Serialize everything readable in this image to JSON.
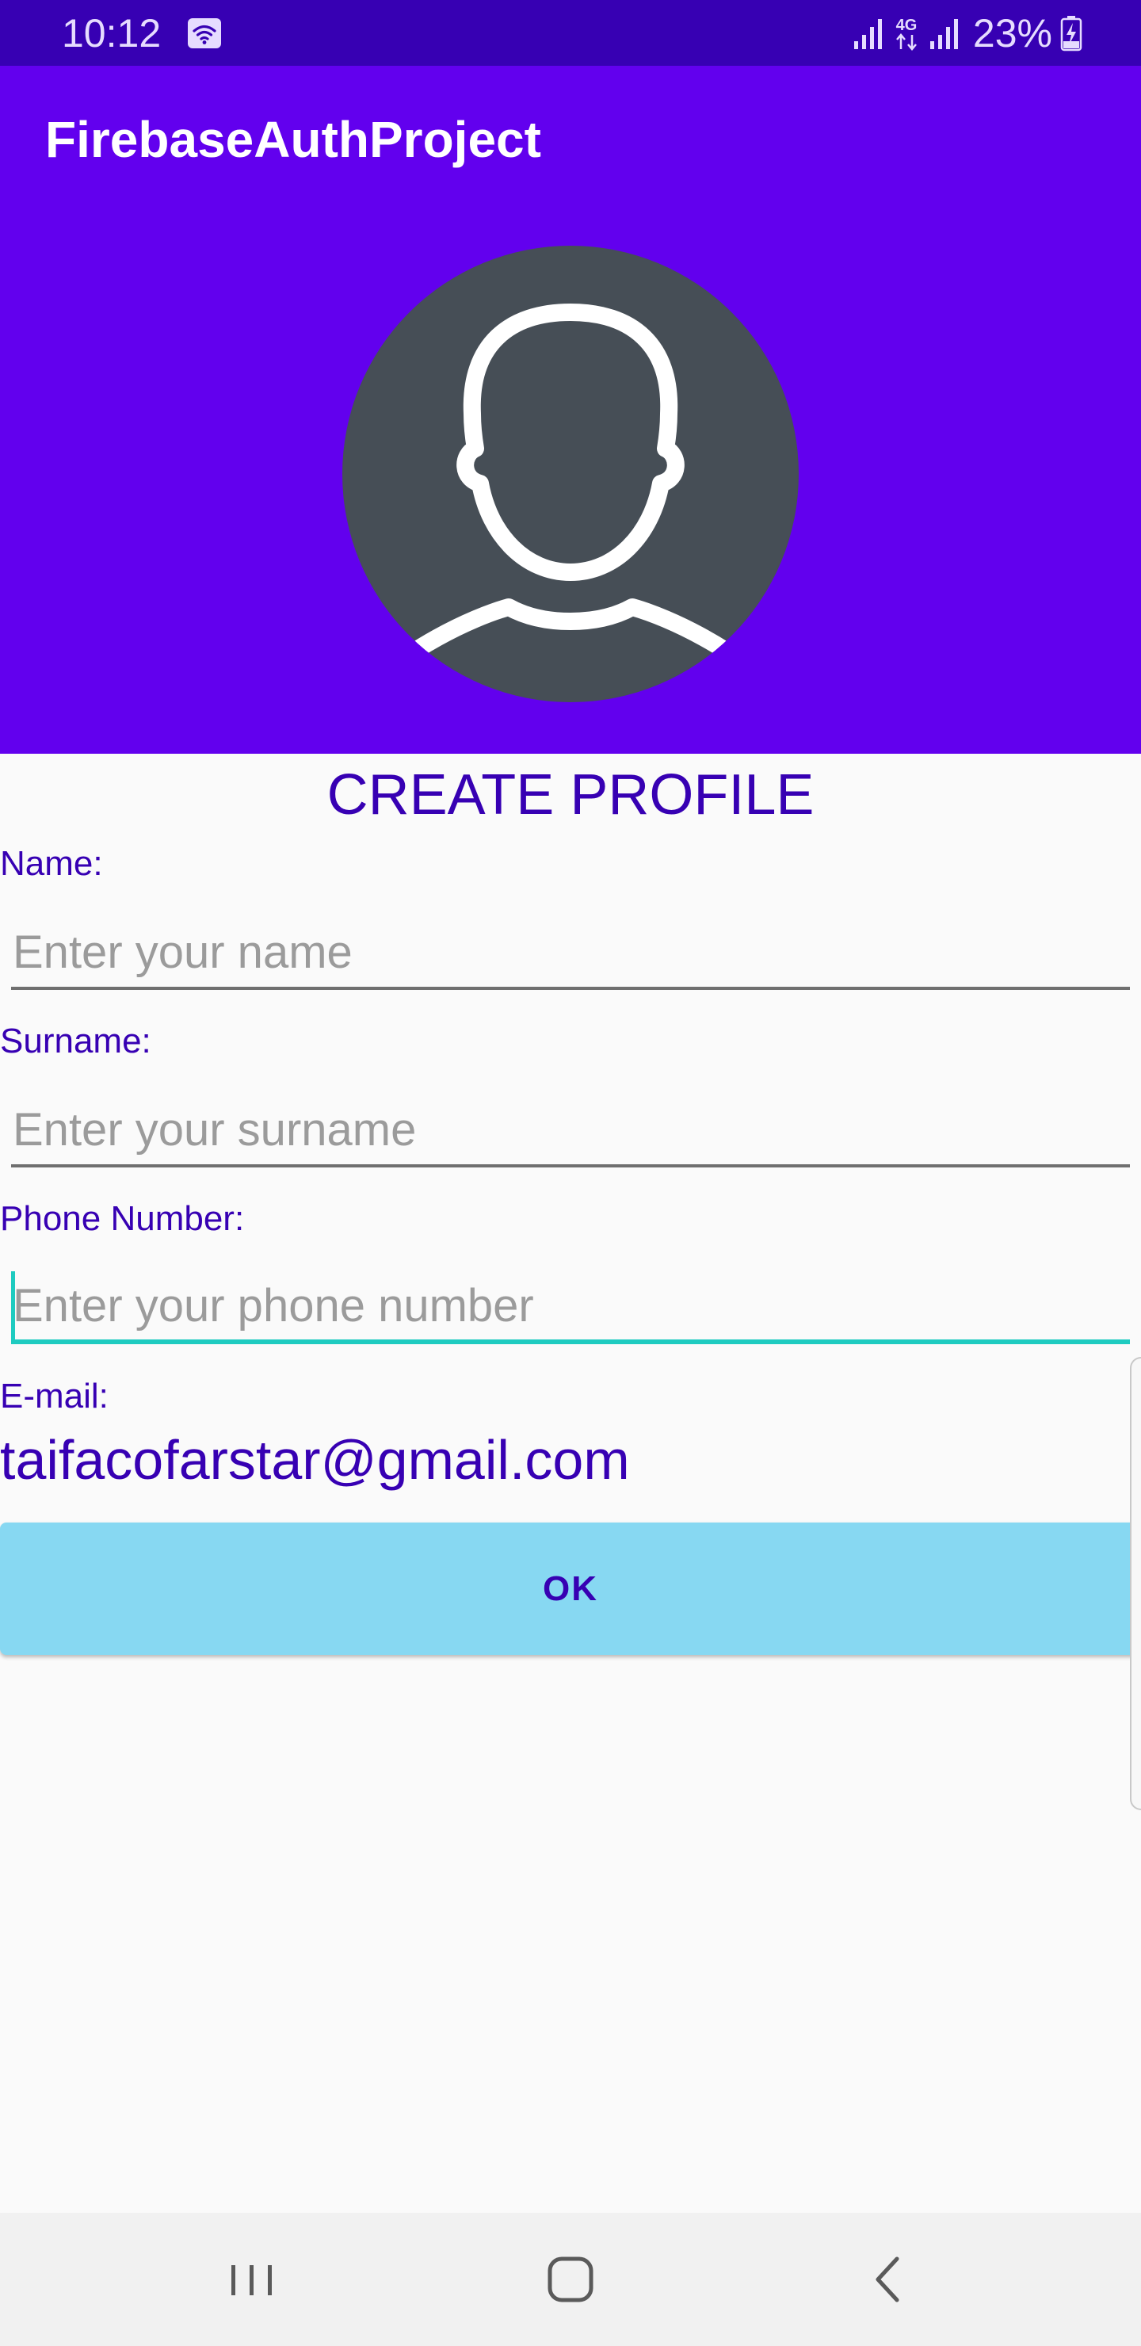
{
  "status_bar": {
    "time": "10:12",
    "network": "4G",
    "battery": "23%"
  },
  "app_bar": {
    "title": "FirebaseAuthProject"
  },
  "profile": {
    "title": "CREATE PROFILE",
    "name": {
      "label": "Name:",
      "placeholder": "Enter your name",
      "value": ""
    },
    "surname": {
      "label": "Surname:",
      "placeholder": "Enter your surname",
      "value": ""
    },
    "phone": {
      "label": "Phone Number:",
      "placeholder": "Enter your phone number",
      "value": ""
    },
    "email": {
      "label": "E-mail:",
      "value": "taifacofarstar@gmail.com"
    },
    "ok_label": "OK"
  },
  "nav_bar": {
    "recents": "recents-icon",
    "home": "home-icon",
    "back": "back-icon"
  },
  "colors": {
    "status_bar": "#3700b3",
    "primary": "#6200ee",
    "text_accent": "#3700b3",
    "focus_underline": "#1ecbc0",
    "button": "#87d8f2",
    "avatar_bg": "#464e56"
  }
}
